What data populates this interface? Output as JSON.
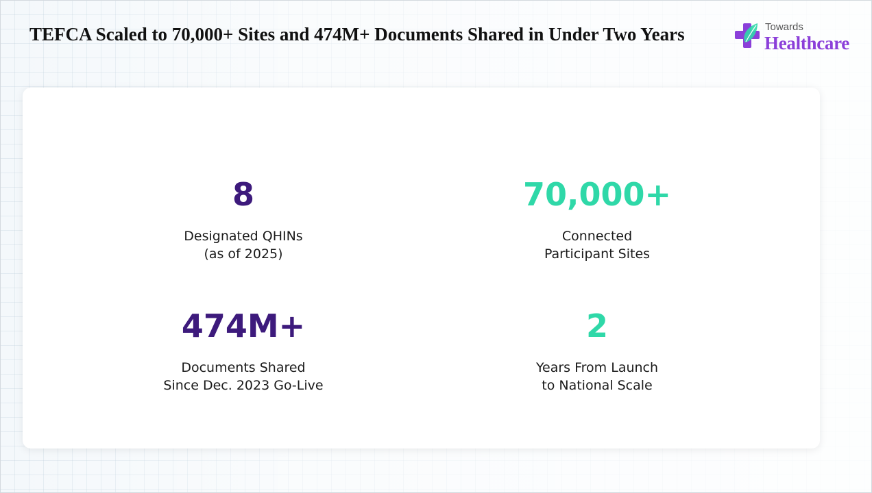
{
  "title": "TEFCA Scaled to 70,000+ Sites and 474M+ Documents Shared in Under Two Years",
  "logo": {
    "icon": "medical-cross-leaf-icon",
    "line1": "Towards",
    "line2": "Healthcare"
  },
  "colors": {
    "primary": "#3d1a7c",
    "accent": "#2fd8a8",
    "brand": "#8b3fd9"
  },
  "stats": [
    {
      "value": "8",
      "label_line1": "Designated QHINs",
      "label_line2": "(as of 2025)"
    },
    {
      "value": "70,000+",
      "label_line1": "Connected",
      "label_line2": "Participant Sites"
    },
    {
      "value": "474M+",
      "label_line1": "Documents Shared",
      "label_line2": "Since Dec. 2023 Go-Live"
    },
    {
      "value": "2",
      "label_line1": "Years From Launch",
      "label_line2": "to National Scale"
    }
  ]
}
